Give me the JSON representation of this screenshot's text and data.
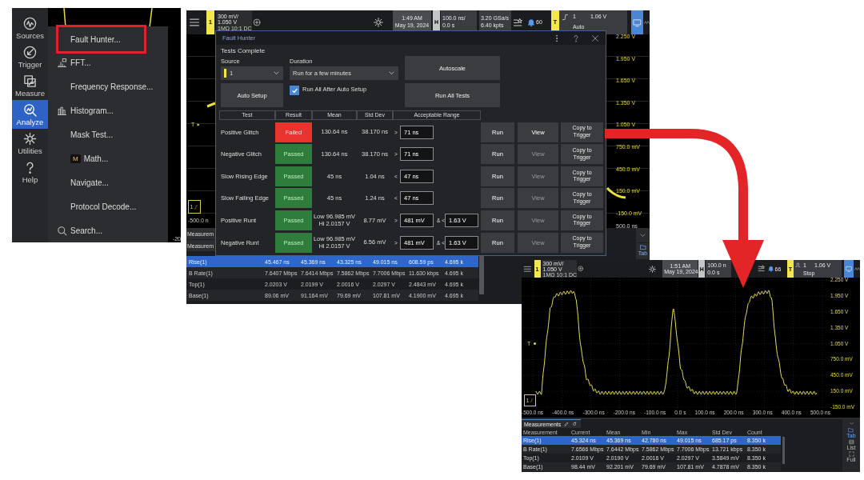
{
  "menu_screen": {
    "sidebar": [
      {
        "kind": "sources",
        "label": "Sources",
        "selected": false
      },
      {
        "kind": "trigger",
        "label": "Trigger",
        "selected": false
      },
      {
        "kind": "measure",
        "label": "Measure",
        "selected": false
      },
      {
        "kind": "analyze",
        "label": "Analyze",
        "selected": true
      },
      {
        "kind": "utilities",
        "label": "Utilities",
        "selected": false
      },
      {
        "kind": "help",
        "label": "Help",
        "selected": false
      }
    ],
    "menu": [
      {
        "kind": "plain",
        "label": "Fault Hunter...",
        "highlighted": true
      },
      {
        "kind": "fft",
        "label": "FFT...",
        "highlighted": false
      },
      {
        "kind": "plain",
        "label": "Frequency Response...",
        "highlighted": false
      },
      {
        "kind": "histogram",
        "label": "Histogram...",
        "highlighted": false
      },
      {
        "kind": "plain",
        "label": "Mask Test...",
        "highlighted": false
      },
      {
        "kind": "math",
        "badge": "M",
        "label": "Math...",
        "highlighted": false
      },
      {
        "kind": "plain",
        "label": "Navigate...",
        "highlighted": false
      },
      {
        "kind": "plain",
        "label": "Protocol Decode...",
        "highlighted": false
      },
      {
        "kind": "search",
        "label": "Search...",
        "highlighted": false
      }
    ],
    "axis_label": "-20"
  },
  "fault_hunter_screen": {
    "top_bar": {
      "channel": "1",
      "scale": "300 mV/",
      "offset": "1.050 V",
      "coupling": "1MΩ 10:1 DC",
      "time": "1:49 AM",
      "date": "May 19, 2024",
      "horizontal": "H",
      "timebase": "100.0 ns/",
      "delay": "0.0 s",
      "sample_rate": "3.20 GSa/s",
      "memory": "6.40 kpts",
      "notifications": "60",
      "trigger": {
        "kind": "edge",
        "badge": "T",
        "source": "1",
        "level": "1.06 V",
        "mode": "Auto"
      }
    },
    "trigger_marker": "T",
    "channel_marker": "1",
    "x_axis": [
      "-500.0 n",
      "500.0 ns"
    ],
    "y_axis": [
      "2.250 V",
      "1.950 V",
      "1.650 V",
      "1.350 V",
      "1.050 V",
      "750.0 mV",
      "450.0 mV",
      "150.0 mV",
      "-150.0 mV"
    ],
    "dialog": {
      "title": "Fault Hunter",
      "status": "Tests Complete",
      "source_label": "Source",
      "source": "1",
      "duration_label": "Duration",
      "duration": "Run for a few minutes",
      "auto_setup": "Auto Setup",
      "run_all_after": {
        "label": "Run All After Auto Setup",
        "checked": true
      },
      "autoscale": "Autoscale",
      "run_all": "Run All Tests",
      "columns": [
        "Test",
        "Result",
        "Mean",
        "Std Dev",
        "Acceptable Range"
      ],
      "rows": [
        {
          "test": "Positive Glitch",
          "result": "Failed",
          "kind": "failed",
          "mean": "130.64 ns",
          "std_dev": "38.170 ns",
          "limits": [
            {
              "op": ">",
              "value": "71 ns"
            }
          ],
          "run": "Run",
          "view": "View",
          "view_disabled": false,
          "copy": "Copy to Trigger"
        },
        {
          "test": "Negative Glitch",
          "result": "Passed",
          "kind": "passed",
          "mean": "130.64 ns",
          "std_dev": "38.170 ns",
          "limits": [
            {
              "op": ">",
              "value": "71 ns"
            }
          ],
          "run": "Run",
          "view": "View",
          "view_disabled": true,
          "copy": "Copy to Trigger"
        },
        {
          "test": "Slow Rising Edge",
          "result": "Passed",
          "kind": "passed",
          "mean": "45 ns",
          "std_dev": "1.04 ns",
          "limits": [
            {
              "op": "<",
              "value": "47 ns"
            }
          ],
          "run": "Run",
          "view": "View",
          "view_disabled": true,
          "copy": "Copy to Trigger"
        },
        {
          "test": "Slow Falling Edge",
          "result": "Passed",
          "kind": "passed",
          "mean": "45 ns",
          "std_dev": "1.24 ns",
          "limits": [
            {
              "op": "<",
              "value": "47 ns"
            }
          ],
          "run": "Run",
          "view": "View",
          "view_disabled": true,
          "copy": "Copy to Trigger"
        },
        {
          "test": "Positive Runt",
          "result": "Passed",
          "kind": "passed",
          "mean": "Low 96.985 mV\nHi 2.0157 V",
          "std_dev": "8.77 mV",
          "limits": [
            {
              "op": ">",
              "value": "481 mV"
            },
            {
              "op": "& <",
              "value": "1.63 V"
            }
          ],
          "run": "Run",
          "view": "View",
          "view_disabled": true,
          "copy": "Copy to Trigger"
        },
        {
          "test": "Negative Runt",
          "result": "Passed",
          "kind": "passed",
          "mean": "Low 96.985 mV\nHi 2.0157 V",
          "std_dev": "6.56 mV",
          "limits": [
            {
              "op": ">",
              "value": "481 mV"
            },
            {
              "op": "& <",
              "value": "1.63 V"
            }
          ],
          "run": "Run",
          "view": "View",
          "view_disabled": true,
          "copy": "Copy to Trigger"
        }
      ]
    },
    "measurement_tabs": [
      "Measurem",
      "Measurem"
    ],
    "measurements": [
      {
        "selected": true,
        "cells": [
          "Rise(1)",
          "45.467 ns",
          "45.369 ns",
          "43.325 ns",
          "49.015 ns",
          "608.59 ps",
          "4.695 k"
        ]
      },
      {
        "selected": false,
        "cells": [
          "B Rate(1)",
          "7.6407 Mbps",
          "7.6414 Mbps",
          "7.5862 Mbps",
          "7.7006 Mbps",
          "11.630 kbps",
          "4.695 k"
        ]
      },
      {
        "selected": false,
        "cells": [
          "Top(1)",
          "2.0203 V",
          "2.0199 V",
          "2.0016 V",
          "2.0297 V",
          "2.4843 mV",
          "4.695 k"
        ]
      },
      {
        "selected": false,
        "cells": [
          "Base(1)",
          "89.06 mV",
          "91.164 mV",
          "79.69 mV",
          "107.81 mV",
          "4.1900 mV",
          "4.695 k"
        ]
      }
    ],
    "tab_button": "Tab"
  },
  "capture_screen": {
    "top_bar": {
      "channel": "1",
      "scale": "300 mV/",
      "offset": "1.050 V",
      "coupling": "1MΩ 10:1 DC",
      "time": "1:51 AM",
      "date": "May 19, 2024",
      "horizontal": "H",
      "timebase": "100.0 n",
      "delay": "0.0 s",
      "notifications": "66",
      "trigger": {
        "kind": "pulse",
        "badge": "T",
        "source": "1",
        "level": "1.06 V",
        "mode": "Stop"
      }
    },
    "trigger_marker": "T",
    "channel_marker": "1",
    "y_axis": [
      "2.250 V",
      "1.950 V",
      "1.650 V",
      "1.350 V",
      "1.050 V",
      "750.0 mV",
      "450.0 mV",
      "150.0 mV",
      "-150.0 mV"
    ],
    "x_axis": [
      "-500.0 ns",
      "-400.0 ns",
      "-300.0 ns",
      "-200.0 ns",
      "-100.0 ns",
      "0.0 s",
      "100.0 ns",
      "200.0 ns",
      "300.0 ns",
      "400.0 ns",
      "500.0 ns"
    ],
    "measurements": {
      "tab": "Measurements",
      "columns": [
        "Measurement",
        "Current",
        "Mean",
        "Min",
        "Max",
        "Std Dev",
        "Count"
      ],
      "rows": [
        {
          "selected": true,
          "cells": [
            "Rise(1)",
            "45.324 ns",
            "45.369 ns",
            "42.780 ns",
            "49.015 ns",
            "685.17 ps",
            "8.350 k"
          ]
        },
        {
          "selected": false,
          "cells": [
            "B Rate(1)",
            "7.6566 Mbps",
            "7.6442 Mbps",
            "7.5862 Mbps",
            "7.7006 Mbps",
            "13.721 kbps",
            "8.350 k"
          ]
        },
        {
          "selected": false,
          "cells": [
            "Top(1)",
            "2.0109 V",
            "2.0190 V",
            "2.0016 V",
            "2.0297 V",
            "3.5849 mV",
            "8.350 k"
          ]
        },
        {
          "selected": false,
          "cells": [
            "Base(1)",
            "98.44 mV",
            "92.201 mV",
            "79.69 mV",
            "107.81 mV",
            "4.7878 mV",
            "8.350 k"
          ]
        }
      ]
    },
    "side_buttons": [
      {
        "kind": "tab",
        "label": "Tab",
        "selected": true
      },
      {
        "kind": "list",
        "label": "List",
        "selected": false
      },
      {
        "kind": "full",
        "label": "Full",
        "selected": false
      }
    ]
  }
}
